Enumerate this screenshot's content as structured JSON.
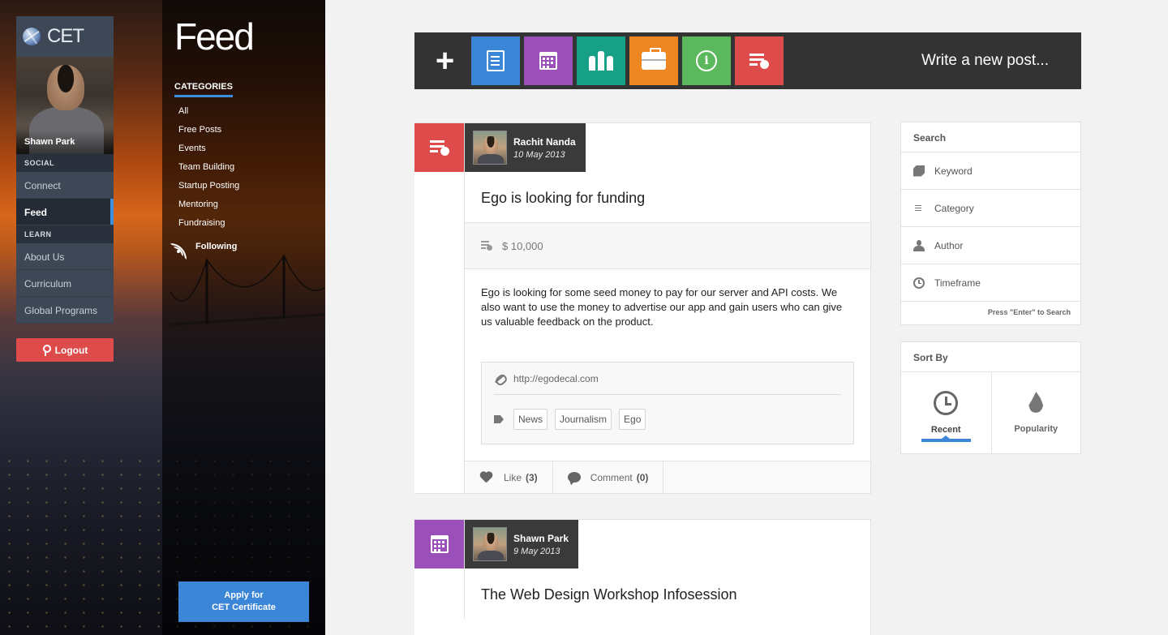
{
  "app": {
    "logo": "CET",
    "page_title": "Feed"
  },
  "user": {
    "name": "Shawn Park"
  },
  "nav": {
    "sections": [
      {
        "label": "SOCIAL",
        "items": [
          "Connect",
          "Feed"
        ]
      },
      {
        "label": "LEARN",
        "items": [
          "About Us",
          "Curriculum",
          "Global Programs"
        ]
      }
    ],
    "active": "Feed",
    "logout": "Logout"
  },
  "categories": {
    "heading": "CATEGORIES",
    "items": [
      "All",
      "Free Posts",
      "Events",
      "Team Building",
      "Startup Posting",
      "Mentoring",
      "Fundraising"
    ],
    "following": "Following"
  },
  "apply": {
    "line1": "Apply for",
    "line2": "CET Certificate"
  },
  "toolbar": {
    "plus": "+",
    "buttons": [
      {
        "icon": "document-icon",
        "color": "#3c86d8"
      },
      {
        "icon": "calendar-icon",
        "color": "#9b4fb8"
      },
      {
        "icon": "team-icon",
        "color": "#16a086"
      },
      {
        "icon": "briefcase-icon",
        "color": "#ee8622"
      },
      {
        "icon": "info-icon",
        "color": "#5cb85c"
      },
      {
        "icon": "money-icon",
        "color": "#de4b4b"
      }
    ],
    "write": "Write a new post..."
  },
  "posts": [
    {
      "type_icon": "money-icon",
      "type_color": "#de4b4b",
      "author": "Rachit Nanda",
      "date": "10 May 2013",
      "title": "Ego is looking for funding",
      "amount": "$ 10,000",
      "body": "Ego is looking for some seed money to pay for our server and API costs. We also want to use the money to advertise our app and gain users who can give us valuable feedback on the product.",
      "link": "http://egodecal.com",
      "tags": [
        "News",
        "Journalism",
        "Ego"
      ],
      "like_label": "Like",
      "like_count": "(3)",
      "comment_label": "Comment",
      "comment_count": "(0)"
    },
    {
      "type_icon": "calendar-icon",
      "type_color": "#9b4fb8",
      "author": "Shawn Park",
      "date": "9 May 2013",
      "title": "The Web Design Workshop Infosession"
    }
  ],
  "search": {
    "heading": "Search",
    "fields": [
      "Keyword",
      "Category",
      "Author",
      "Timeframe"
    ],
    "hint": "Press \"Enter\" to Search"
  },
  "sort": {
    "heading": "Sort By",
    "options": [
      "Recent",
      "Popularity"
    ],
    "active": "Recent"
  }
}
